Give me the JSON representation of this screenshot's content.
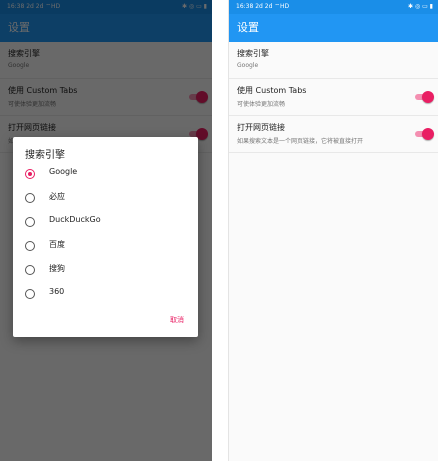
{
  "status_bar": {
    "time": "16:38",
    "signal": "2d 2d",
    "wifi": "HD",
    "icons": "✱ ◎ ▭ ▮"
  },
  "app_bar": {
    "title": "设置"
  },
  "settings": [
    {
      "title": "搜索引擎",
      "subtitle": "Google"
    },
    {
      "title": "使用 Custom Tabs",
      "subtitle": "可使体验更加流畅"
    },
    {
      "title": "打开网页链接",
      "subtitle": "如果搜索文本是一个网页链接，它将被直接打开"
    }
  ],
  "dialog": {
    "title": "搜索引擎",
    "options": [
      "Google",
      "必应",
      "DuckDuckGo",
      "百度",
      "搜狗",
      "360"
    ],
    "selected": "Google",
    "cancel_label": "取消"
  },
  "colors": {
    "primary": "#2196f3",
    "status_bar": "#1a8ee8",
    "accent": "#e91e63"
  }
}
